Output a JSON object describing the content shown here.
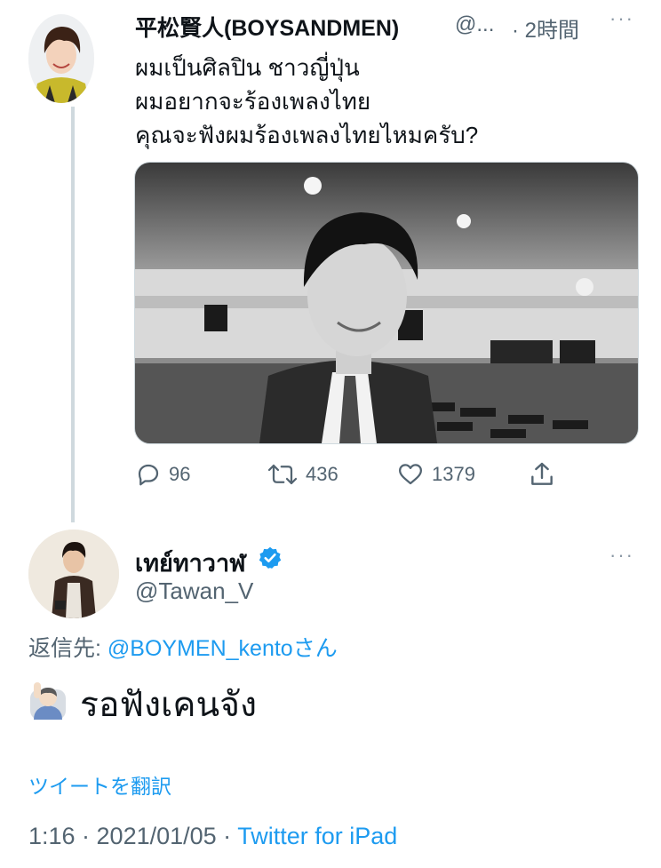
{
  "parent_tweet": {
    "author_name": "平松賢人(BOYSANDMEN)",
    "handle": "@...",
    "time": "· 2時間",
    "more": "···",
    "lines": [
      "ผมเป็นศิลปิน ชาวญี่ปุ่น",
      "ผมอยากจะร้องเพลงไทย",
      "คุณจะฟังผมร้องเพลงไทยไหมครับ?"
    ],
    "actions": {
      "replies": "96",
      "retweets": "436",
      "likes": "1379"
    }
  },
  "reply_tweet": {
    "author_name": "เทย์ทาวาฬ",
    "handle": "@Tawan_V",
    "more": "···",
    "reply_to_label": "返信先: ",
    "reply_to_handle": "@BOYMEN_kentoさん",
    "text": "รอฟังเคนจัง",
    "translate": "ツイートを翻訳",
    "timestamp": "1:16 · 2021/01/05 · ",
    "source": "Twitter for iPad"
  },
  "colors": {
    "link": "#1d9bf0",
    "secondary": "#536471",
    "verified": "#1d9bf0",
    "thread_line": "#cfd9de"
  },
  "icons": [
    "reply-icon",
    "retweet-icon",
    "like-icon",
    "share-icon",
    "verified-badge-icon",
    "raising-hand-emoji-icon",
    "more-icon"
  ]
}
